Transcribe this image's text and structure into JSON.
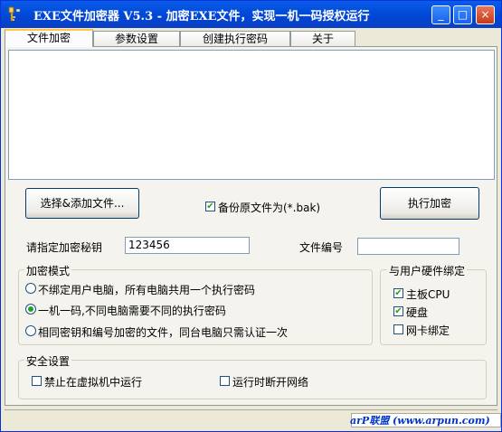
{
  "window": {
    "title": "EXE文件加密器 V5.3 - 加密EXE文件，实现一机一码授权运行",
    "minimize_glyph": "_",
    "maximize_glyph": "□",
    "close_glyph": "×"
  },
  "tabs": [
    "文件加密",
    "参数设置",
    "创建执行密码",
    "关于"
  ],
  "actions": {
    "add_file_label": "选择&添加文件...",
    "backup_label": "备份原文件为(*.bak)",
    "backup_checked": true,
    "encrypt_label": "执行加密"
  },
  "fields": {
    "key_label": "请指定加密秘钥",
    "key_value": "123456",
    "file_no_label": "文件编号",
    "file_no_value": ""
  },
  "encrypt_mode": {
    "legend": "加密模式",
    "options": [
      {
        "label": "不绑定用户电脑，所有电脑共用一个执行密码",
        "selected": false
      },
      {
        "label": "一机一码,不同电脑需要不同的执行密码",
        "selected": true
      },
      {
        "label": "相同密钥和编号加密的文件，同台电脑只需认证一次",
        "selected": false
      }
    ]
  },
  "hardware_bind": {
    "legend": "与用户硬件绑定",
    "items": [
      {
        "label": "主板CPU",
        "checked": true
      },
      {
        "label": "硬盘",
        "checked": true
      },
      {
        "label": "网卡绑定",
        "checked": false
      }
    ]
  },
  "security": {
    "legend": "安全设置",
    "items": [
      {
        "label": "禁止在虚拟机中运行",
        "checked": false
      },
      {
        "label": "运行时断开网络",
        "checked": false
      }
    ]
  },
  "status": {
    "text": "arP联盟 (www.arpun.com)"
  },
  "colors": {
    "titlebar": "#0047d6",
    "check_mark": "#21a121",
    "tab_highlight": "#ffc83c",
    "status_text": "#0033cc"
  },
  "icons": {
    "app": "key-icon",
    "check": "check-icon"
  }
}
